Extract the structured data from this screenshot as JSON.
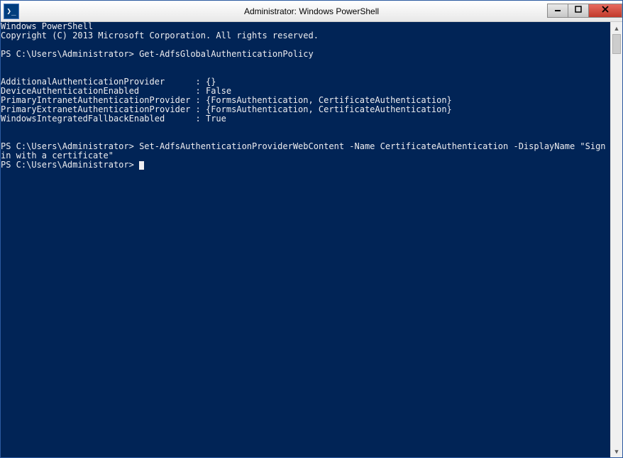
{
  "window": {
    "title": "Administrator: Windows PowerShell",
    "icon_glyph": "❯_"
  },
  "controls": {
    "minimize": "—",
    "maximize": "□",
    "close": "✕"
  },
  "console": {
    "line1": "Windows PowerShell",
    "line2": "Copyright (C) 2013 Microsoft Corporation. All rights reserved.",
    "blank1": "",
    "prompt1": "PS C:\\Users\\Administrator> ",
    "cmd1": "Get-AdfsGlobalAuthenticationPolicy",
    "blank2": "",
    "blank3": "",
    "out1": "AdditionalAuthenticationProvider      : {}",
    "out2": "DeviceAuthenticationEnabled           : False",
    "out3": "PrimaryIntranetAuthenticationProvider : {FormsAuthentication, CertificateAuthentication}",
    "out4": "PrimaryExtranetAuthenticationProvider : {FormsAuthentication, CertificateAuthentication}",
    "out5": "WindowsIntegratedFallbackEnabled      : True",
    "blank4": "",
    "blank5": "",
    "prompt2": "PS C:\\Users\\Administrator> ",
    "cmd2": "Set-AdfsAuthenticationProviderWebContent -Name CertificateAuthentication -DisplayName \"Sign in with a certificate\"",
    "prompt3": "PS C:\\Users\\Administrator> "
  },
  "scrollbar": {
    "up": "▲",
    "down": "▼"
  }
}
